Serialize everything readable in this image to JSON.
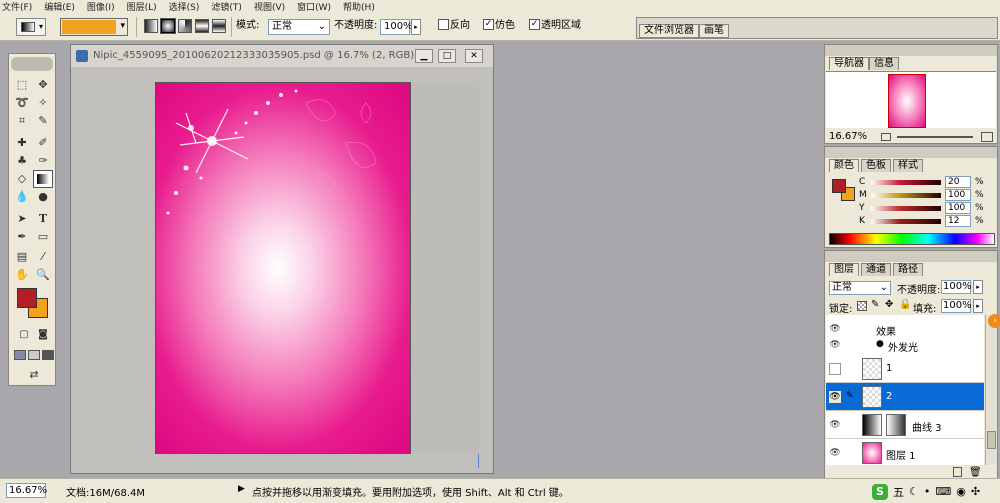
{
  "menu": [
    "文件(F)",
    "编辑(E)",
    "图像(I)",
    "图层(L)",
    "选择(S)",
    "滤镜(T)",
    "视图(V)",
    "窗口(W)",
    "帮助(H)"
  ],
  "options": {
    "mode_label": "模式:",
    "mode_value": "正常",
    "opacity_label": "不透明度:",
    "opacity_value": "100%",
    "reverse_label": "反向",
    "dither_label": "仿色",
    "transparency_label": "透明区域",
    "tabs": [
      "文件浏览器",
      "画笔"
    ],
    "gradient_color": "#f2a21d"
  },
  "document": {
    "title": "Nipic_4559095_20100620212333035905.psd @ 16.7% (2, RGB)"
  },
  "navigator": {
    "tabs": [
      "导航器",
      "信息"
    ],
    "zoom": "16.67%"
  },
  "color_panel": {
    "tabs": [
      "颜色",
      "色板",
      "样式"
    ],
    "channels": [
      {
        "label": "C",
        "value": "20",
        "color": "#cc1c3c"
      },
      {
        "label": "M",
        "value": "100",
        "color": "#c29a18"
      },
      {
        "label": "Y",
        "value": "100",
        "color": "#c03030"
      },
      {
        "label": "K",
        "value": "12",
        "color": "#992020"
      }
    ],
    "percent": "%",
    "fg_color": "#b21e25",
    "bg_color": "#f2a21d"
  },
  "layers_panel": {
    "tabs": [
      "图层",
      "通道",
      "路径"
    ],
    "blend_mode": "正常",
    "opacity_label": "不透明度:",
    "opacity_value": "100%",
    "lock_label": "锁定:",
    "fill_label": "填充:",
    "fill_value": "100%",
    "rows": [
      {
        "name": "效果",
        "kind": "effect-header"
      },
      {
        "name": "外发光",
        "kind": "effect"
      },
      {
        "name": "1",
        "kind": "layer"
      },
      {
        "name": "2",
        "kind": "layer-selected"
      },
      {
        "name": "曲线 3",
        "kind": "adjustment"
      },
      {
        "name": "图层 1",
        "kind": "layer"
      }
    ]
  },
  "status": {
    "zoom": "16.67%",
    "doc_info": "文档:16M/68.4M",
    "hint": "点按并拖移以用渐变填充。要用附加选项，使用 Shift、Alt 和 Ctrl 键。"
  },
  "tray": {
    "ime_label": "五"
  }
}
